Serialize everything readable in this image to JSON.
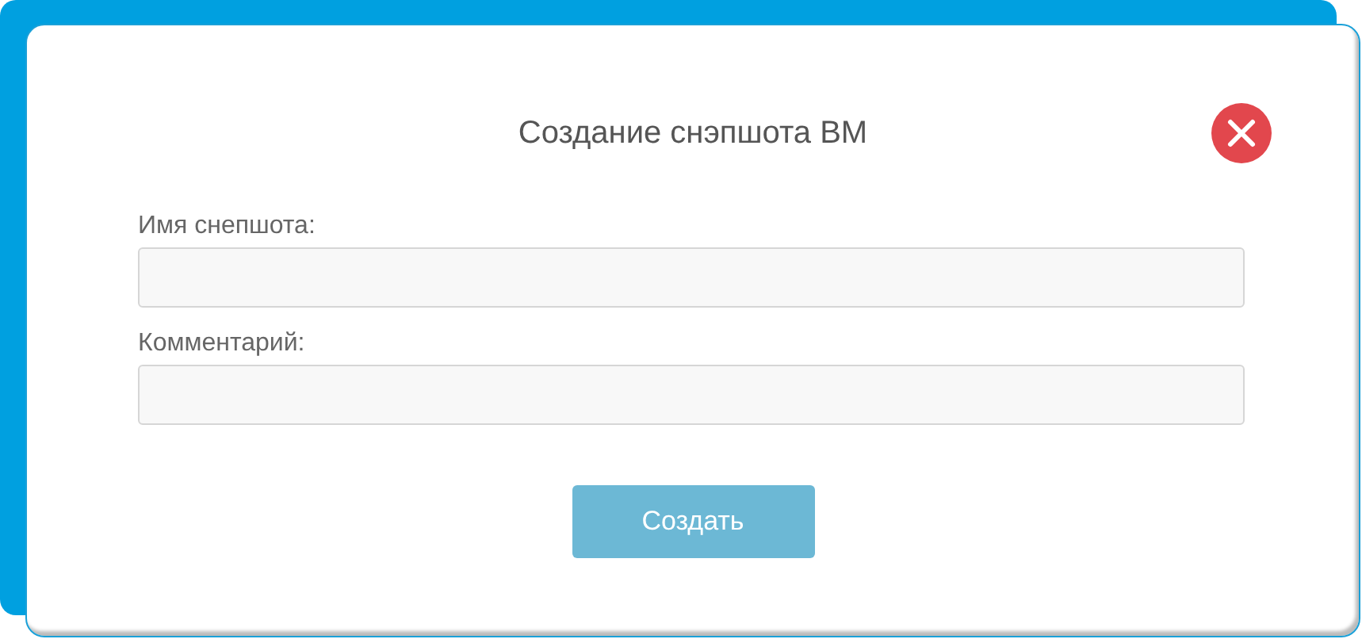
{
  "dialog": {
    "title": "Создание снэпшота ВМ",
    "fields": [
      {
        "label": "Имя снепшота:"
      },
      {
        "label": "Комментарий:"
      }
    ],
    "submit_button": "Создать"
  }
}
